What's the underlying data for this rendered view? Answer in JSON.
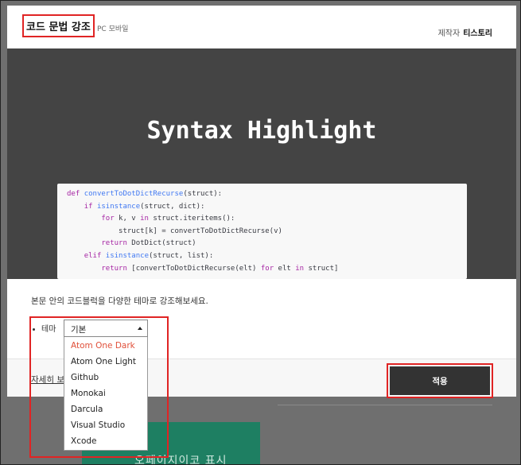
{
  "header": {
    "title": "코드 문법 강조",
    "subtitle": "PC 모바일",
    "maker_label": "제작자",
    "maker_name": "티스토리"
  },
  "preview": {
    "heading": "Syntax Highlight",
    "code_lines": [
      "def convertToDotDictRecurse(struct):",
      "    if isinstance(struct, dict):",
      "        for k, v in struct.iteritems():",
      "            struct[k] = convertToDotDictRecurse(v)",
      "        return DotDict(struct)",
      "    elif isinstance(struct, list):",
      "        return [convertToDotDictRecurse(elt) for elt in struct]"
    ]
  },
  "body": {
    "description": "본문 안의 코드블럭을 다양한 테마로 강조해보세요.",
    "theme_label": "테마",
    "theme_selected": "기본",
    "theme_options": [
      "Atom One Dark",
      "Atom One Light",
      "Github",
      "Monokai",
      "Darcula",
      "Visual Studio",
      "Xcode"
    ],
    "highlighted_option": "Atom One Dark",
    "detail_link": "자세히 보기",
    "apply_label": "적용"
  },
  "background": {
    "teal_text": "오페이지이코 표시"
  },
  "colors": {
    "annotation": "#e02424",
    "apply_bg": "#333333",
    "active_option": "#e0503a",
    "preview_bg": "#444444",
    "teal": "#1e7f62"
  }
}
